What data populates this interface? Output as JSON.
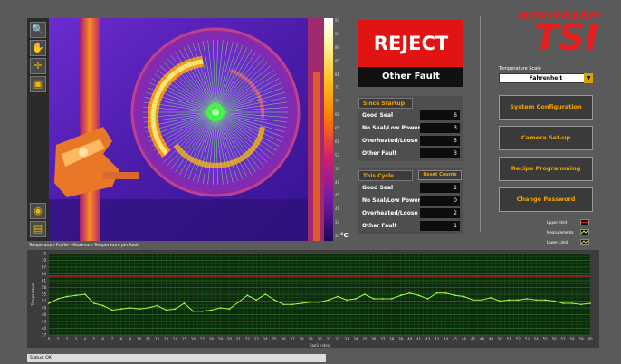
{
  "toolbar": {
    "tools": [
      {
        "name": "zoom-icon",
        "glyph": "🔍"
      },
      {
        "name": "pan-hand-icon",
        "glyph": "✋"
      },
      {
        "name": "crosshair-icon",
        "glyph": "✛"
      },
      {
        "name": "image-icon",
        "glyph": "▣"
      }
    ],
    "bottom_tools": [
      {
        "name": "camera-icon",
        "glyph": "◉"
      },
      {
        "name": "save-image-icon",
        "glyph": "▤"
      }
    ]
  },
  "thermal": {
    "unit": "°C",
    "scale_ticks": [
      "97",
      "93",
      "89",
      "85",
      "81",
      "77",
      "73",
      "69",
      "65",
      "61",
      "57",
      "53",
      "49",
      "45",
      "41",
      "37",
      "33"
    ]
  },
  "status_box": {
    "result": "REJECT",
    "reason": "Other Fault",
    "result_color": "#e11313"
  },
  "since_startup": {
    "title": "Since Startup",
    "rows": [
      {
        "label": "Good Seal",
        "value": "6"
      },
      {
        "label": "No Seal/Low Power",
        "value": "3"
      },
      {
        "label": "Overheated/Loose",
        "value": "5"
      },
      {
        "label": "Other Fault",
        "value": "3"
      }
    ]
  },
  "this_cycle": {
    "title": "This Cycle",
    "reset_label": "Reset Counts",
    "rows": [
      {
        "label": "Good Seal",
        "value": "1"
      },
      {
        "label": "No Seal/Low Power",
        "value": "0"
      },
      {
        "label": "Overheated/Loose",
        "value": "2"
      },
      {
        "label": "Other Fault",
        "value": "1"
      }
    ]
  },
  "logo": {
    "top": "MOVITHERM",
    "main": "TSI",
    "color": "#e51d1d"
  },
  "temp_scale": {
    "label": "Temperature Scale",
    "value": "Fahrenheit"
  },
  "buttons": {
    "system_config": "System Configuration",
    "camera_setup": "Camera Set-up",
    "recipe": "Recipe Programming",
    "password": "Change Password"
  },
  "legend": {
    "upper": "Upper limit",
    "measurements": "Measurements",
    "lower": "Lower Limit",
    "upper_color": "#d42020",
    "meas_color": "#a8ff3a",
    "lower_color": "#e6d020"
  },
  "chart_title": "Temperature Profile - Maximum Temperature per Radii",
  "status_text": "Status: OK",
  "chart_data": {
    "type": "line",
    "ylabel": "Temperature",
    "xlabel": "Radii Index",
    "ylim": [
      37,
      73
    ],
    "upper_limit": 63,
    "x": [
      0,
      1,
      2,
      3,
      4,
      5,
      6,
      7,
      8,
      9,
      10,
      11,
      12,
      13,
      14,
      15,
      16,
      17,
      18,
      19,
      20,
      21,
      22,
      23,
      24,
      25,
      26,
      27,
      28,
      29,
      30,
      31,
      32,
      33,
      34,
      35,
      36,
      37,
      38,
      39,
      40,
      41,
      42,
      43,
      44,
      45,
      46,
      47,
      48,
      49,
      50,
      51,
      52,
      53,
      54,
      55,
      56,
      57,
      58,
      59,
      60
    ],
    "y_ticks": [
      73,
      70,
      67,
      64,
      61,
      58,
      55,
      52,
      49,
      46,
      43,
      40,
      37
    ],
    "series": [
      {
        "values": [
          51,
          53,
          54,
          54.5,
          55,
          51,
          50,
          48,
          48.5,
          49,
          48.5,
          49,
          50,
          48,
          48.5,
          51,
          47.5,
          47.5,
          48,
          49,
          48.5,
          51.5,
          54.5,
          52.5,
          55,
          52.5,
          50.5,
          50.5,
          51,
          51.5,
          51.5,
          52.5,
          54,
          52.5,
          53,
          55,
          53,
          53,
          53,
          54.5,
          55.5,
          54.5,
          53,
          55.5,
          55.5,
          54.5,
          54,
          52.5,
          52.5,
          53.5,
          52,
          52.5,
          52.5,
          53,
          52.5,
          52.5,
          52,
          51,
          51,
          50.5,
          51
        ]
      }
    ]
  }
}
